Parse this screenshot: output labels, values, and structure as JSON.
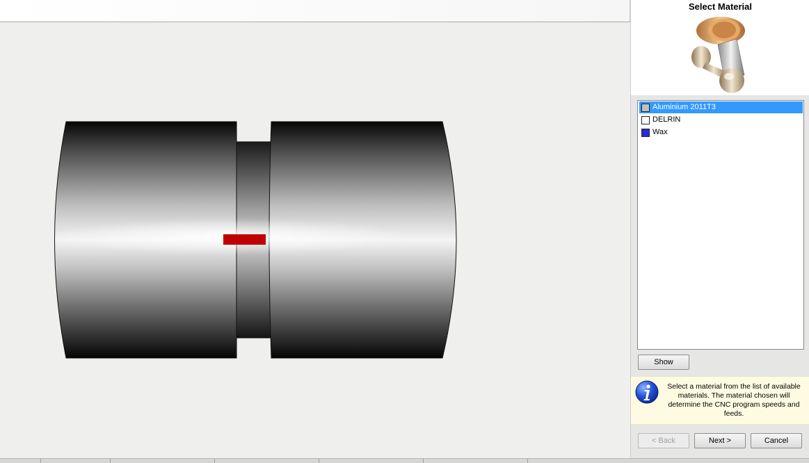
{
  "panel": {
    "title": "Select Material",
    "materials": [
      {
        "label": "Aluminium 2011T3",
        "color": "#c0c0c0",
        "selected": true
      },
      {
        "label": "DELRIN",
        "color": "#ffffff",
        "selected": false
      },
      {
        "label": "Wax",
        "color": "#2a2ad8",
        "selected": false
      }
    ],
    "show_label": "Show",
    "info_text": "Select a material from the list of available materials. The material chosen will determine the CNC program speeds and feeds.",
    "back_label": "< Back",
    "next_label": "Next >",
    "cancel_label": "Cancel"
  },
  "colors": {
    "selection": "#3399ff",
    "marker": "#c00000"
  }
}
